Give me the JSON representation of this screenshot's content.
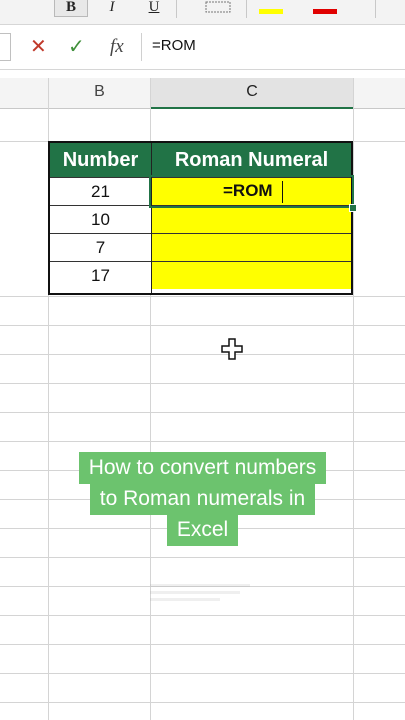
{
  "ribbon": {
    "bold_label": "B",
    "italic_label": "I",
    "underline_label": "U",
    "fill_color": "#ffff00",
    "font_color": "#e00000"
  },
  "formula_bar": {
    "cancel_icon": "✕",
    "enter_icon": "✓",
    "fx_label": "fx",
    "value": "=ROM"
  },
  "columns": [
    "B",
    "C"
  ],
  "table": {
    "headers": [
      "Number",
      "Roman Numeral"
    ],
    "rows": [
      {
        "number": "21",
        "roman": "=ROM"
      },
      {
        "number": "10",
        "roman": ""
      },
      {
        "number": "7",
        "roman": ""
      },
      {
        "number": "17",
        "roman": ""
      }
    ],
    "header_color": "#217346",
    "highlight_color": "#ffff00"
  },
  "caption": {
    "lines": [
      "How to convert numbers",
      "to Roman numerals in",
      "Excel"
    ],
    "color": "#6cc36e"
  }
}
